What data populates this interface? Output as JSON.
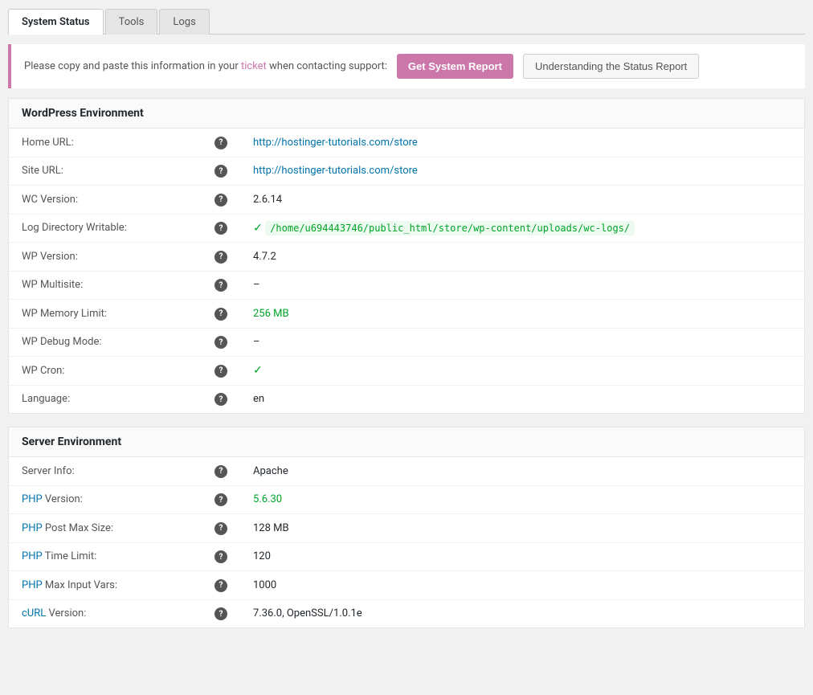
{
  "tabs": [
    {
      "label": "System Status",
      "active": true
    },
    {
      "label": "Tools",
      "active": false
    },
    {
      "label": "Logs",
      "active": false
    }
  ],
  "notice": {
    "text": "Please copy and paste this information in your ",
    "link_text": "ticket",
    "text2": " when contacting support:"
  },
  "buttons": {
    "get_report": "Get System Report",
    "understanding": "Understanding the Status Report"
  },
  "wordpress_section": {
    "title": "WordPress Environment",
    "rows": [
      {
        "label": "Home URL:",
        "value": "http://hostinger-tutorials.com/store",
        "type": "link"
      },
      {
        "label": "Site URL:",
        "value": "http://hostinger-tutorials.com/store",
        "type": "link"
      },
      {
        "label": "WC Version:",
        "value": "2.6.14",
        "type": "text"
      },
      {
        "label": "Log Directory Writable:",
        "value": "/home/u694443746/public_html/store/wp-content/uploads/wc-logs/",
        "type": "check-path"
      },
      {
        "label": "WP Version:",
        "value": "4.7.2",
        "type": "text"
      },
      {
        "label": "WP Multisite:",
        "value": "–",
        "type": "dash"
      },
      {
        "label": "WP Memory Limit:",
        "value": "256 MB",
        "type": "green"
      },
      {
        "label": "WP Debug Mode:",
        "value": "–",
        "type": "dash"
      },
      {
        "label": "WP Cron:",
        "value": "✓",
        "type": "check"
      },
      {
        "label": "Language:",
        "value": "en",
        "type": "text"
      }
    ]
  },
  "server_section": {
    "title": "Server Environment",
    "rows": [
      {
        "label": "Server Info:",
        "value": "Apache",
        "type": "text"
      },
      {
        "label": "PHP Version:",
        "value": "5.6.30",
        "type": "green"
      },
      {
        "label": "PHP Post Max Size:",
        "value": "128 MB",
        "type": "text"
      },
      {
        "label": "PHP Time Limit:",
        "value": "120",
        "type": "text"
      },
      {
        "label": "PHP Max Input Vars:",
        "value": "1000",
        "type": "text"
      },
      {
        "label": "cURL Version:",
        "value": "7.36.0, OpenSSL/1.0.1e",
        "type": "text"
      }
    ]
  },
  "icons": {
    "help": "?",
    "check": "✓"
  }
}
